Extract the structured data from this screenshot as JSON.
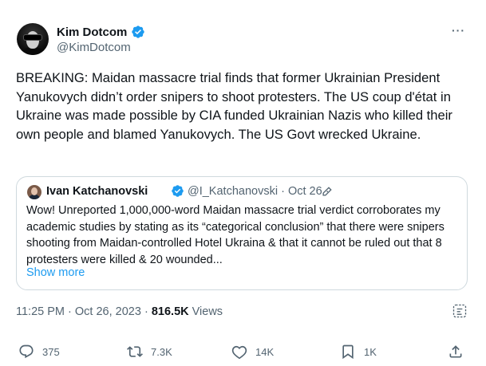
{
  "author": {
    "name": "Kim Dotcom",
    "handle": "@KimDotcom"
  },
  "tweet": {
    "text": "BREAKING: Maidan massacre trial finds that former Ukrainian President Yanukovych didn’t order snipers to shoot protesters. The US coup d'état in Ukraine was made possible by CIA funded Ukrainian Nazis who killed their own people and blamed Yanukovych. The US Govt wrecked Ukraine."
  },
  "quote": {
    "name": "Ivan Katchanovski",
    "handle": "@I_Katchanovski",
    "separator": "·",
    "date": "Oct 26",
    "text": "Wow! Unreported 1,000,000-word Maidan massacre trial verdict corroborates my academic studies by stating as its “categorical conclusion” that there were snipers shooting from Maidan-controlled Hotel Ukraina & that it cannot be ruled out that 8 protesters were killed & 20 wounded...",
    "show_more": "Show more"
  },
  "meta": {
    "time": "11:25 PM",
    "separator": "·",
    "date": "Oct 26, 2023",
    "views_count": "816.5K",
    "views_label": "Views"
  },
  "actions": {
    "replies": "375",
    "reposts": "7.3K",
    "likes": "14K",
    "bookmarks": "1K"
  },
  "icons": {
    "verified_color": "#1d9bf0",
    "action_color": "#536471",
    "link_color": "#1d9bf0"
  }
}
